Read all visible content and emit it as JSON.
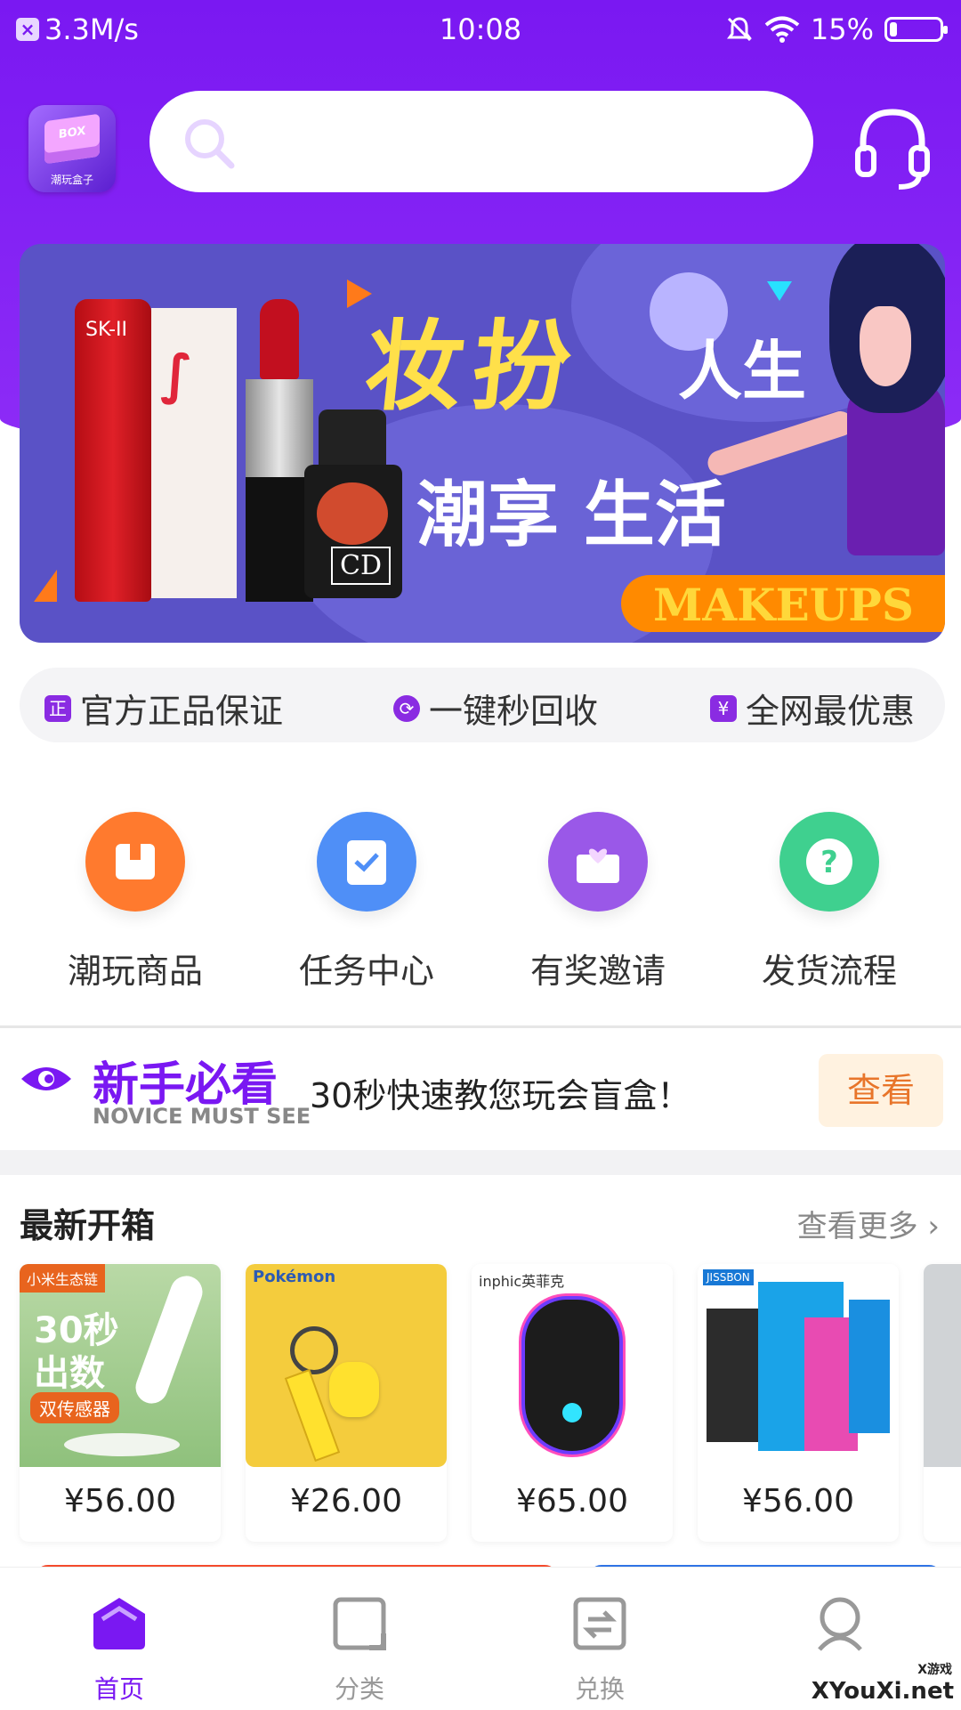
{
  "status_bar": {
    "speed": "3.3M/s",
    "time": "10:08",
    "battery": "15%",
    "battery_level": 0.15
  },
  "header": {
    "logo_box_text": "BOX",
    "logo_caption": "潮玩盒子",
    "search_placeholder": ""
  },
  "banner": {
    "headline": "妆扮",
    "sub1": "人生",
    "sub2": "潮享 生活",
    "badge": "MAKEUPS",
    "brand1": "SK-II",
    "brand2": "CD"
  },
  "benefits": [
    {
      "icon": "certified-icon",
      "label": "官方正品保证"
    },
    {
      "icon": "recycle-icon",
      "label": "一键秒回收"
    },
    {
      "icon": "price-tag-icon",
      "label": "全网最优惠"
    }
  ],
  "quick_actions": [
    {
      "label": "潮玩商品",
      "color": "#ff7a2e"
    },
    {
      "label": "任务中心",
      "color": "#4f8ff7"
    },
    {
      "label": "有奖邀请",
      "color": "#9a58e8"
    },
    {
      "label": "发货流程",
      "color": "#3fd08f"
    }
  ],
  "novice": {
    "title": "新手必看",
    "subtitle": "NOVICE MUST SEE",
    "desc": "30秒快速教您玩会盲盒！",
    "button": "查看"
  },
  "latest": {
    "title": "最新开箱",
    "more": "查看更多",
    "items": [
      {
        "price": "¥56.00",
        "tag": "小米生态链",
        "line1": "30秒",
        "line2": "出数",
        "line3": "双传感器"
      },
      {
        "price": "¥26.00",
        "tag": "Pokémon"
      },
      {
        "price": "¥65.00",
        "tag": "inphic英菲克"
      },
      {
        "price": "¥56.00",
        "tag": "JISSBON"
      }
    ]
  },
  "tabbar": {
    "items": [
      {
        "label": "首页",
        "active": true
      },
      {
        "label": "分类",
        "active": false
      },
      {
        "label": "兑换",
        "active": false
      }
    ]
  },
  "watermark": {
    "main": "XYouXi.net",
    "small": "X游戏"
  }
}
